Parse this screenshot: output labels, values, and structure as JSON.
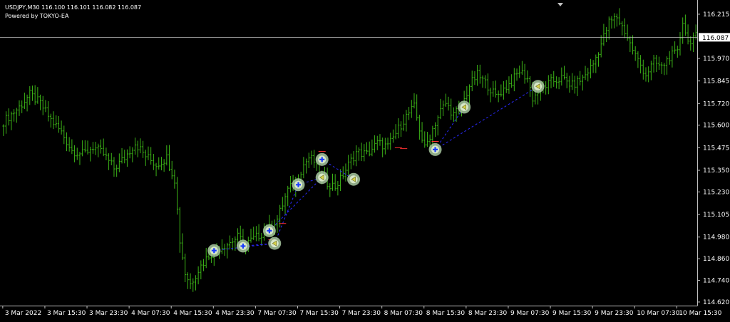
{
  "window": {
    "symbol_line": "USDJPY,M30  116.100 116.101 116.082 116.087",
    "powered_by": "Powered by TOKYO-EA"
  },
  "colors": {
    "background": "#000000",
    "axis": "#c0c0c0",
    "candle": "#3cb317",
    "price_line": "#c0c0c0",
    "current_price_bg": "#ffffff",
    "current_price_text": "#000000",
    "marker_ring": "#a8c8a0",
    "buy_marker": "#1a3cff",
    "sell_marker": "#d6d24a",
    "trade_line": "#2a2aff",
    "level_mark": "#ff3030"
  },
  "chart_data": {
    "type": "candlestick",
    "symbol": "USDJPY",
    "timeframe": "M30",
    "ohlc": [
      116.1,
      116.101,
      116.082,
      116.087
    ],
    "current_price": 116.087,
    "current_price_label": "116.087",
    "ylim": [
      114.6,
      116.27
    ],
    "yticks": [
      {
        "value": 116.215,
        "label": "116.215"
      },
      {
        "value": 115.97,
        "label": "115.970"
      },
      {
        "value": 115.845,
        "label": "115.845"
      },
      {
        "value": 115.72,
        "label": "115.720"
      },
      {
        "value": 115.6,
        "label": "115.600"
      },
      {
        "value": 115.475,
        "label": "115.475"
      },
      {
        "value": 115.35,
        "label": "115.350"
      },
      {
        "value": 115.23,
        "label": "115.230"
      },
      {
        "value": 115.105,
        "label": "115.105"
      },
      {
        "value": 114.98,
        "label": "114.980"
      },
      {
        "value": 114.86,
        "label": "114.860"
      },
      {
        "value": 114.74,
        "label": "114.740"
      },
      {
        "value": 114.62,
        "label": "114.620"
      }
    ],
    "xticks": [
      {
        "index": 0,
        "label": "3 Mar 2022"
      },
      {
        "index": 16,
        "label": "3 Mar 15:30"
      },
      {
        "index": 32,
        "label": "3 Mar 23:30"
      },
      {
        "index": 48,
        "label": "4 Mar 07:30"
      },
      {
        "index": 64,
        "label": "4 Mar 15:30"
      },
      {
        "index": 80,
        "label": "4 Mar 23:30"
      },
      {
        "index": 96,
        "label": "7 Mar 07:30"
      },
      {
        "index": 112,
        "label": "7 Mar 15:30"
      },
      {
        "index": 128,
        "label": "7 Mar 23:30"
      },
      {
        "index": 144,
        "label": "8 Mar 07:30"
      },
      {
        "index": 160,
        "label": "8 Mar 15:30"
      },
      {
        "index": 176,
        "label": "8 Mar 23:30"
      },
      {
        "index": 192,
        "label": "9 Mar 07:30"
      },
      {
        "index": 208,
        "label": "9 Mar 15:30"
      },
      {
        "index": 224,
        "label": "9 Mar 23:30"
      },
      {
        "index": 240,
        "label": "10 Mar 07:30"
      },
      {
        "index": 256,
        "label": "10 Mar 15:30"
      }
    ],
    "anchors": [
      [
        0,
        115.62
      ],
      [
        6,
        115.7
      ],
      [
        10,
        115.77
      ],
      [
        14,
        115.72
      ],
      [
        18,
        115.63
      ],
      [
        22,
        115.56
      ],
      [
        26,
        115.46
      ],
      [
        30,
        115.44
      ],
      [
        34,
        115.48
      ],
      [
        38,
        115.44
      ],
      [
        42,
        115.36
      ],
      [
        46,
        115.42
      ],
      [
        50,
        115.5
      ],
      [
        54,
        115.43
      ],
      [
        58,
        115.38
      ],
      [
        62,
        115.42
      ],
      [
        65,
        115.3
      ],
      [
        67,
        114.96
      ],
      [
        69,
        114.78
      ],
      [
        71,
        114.72
      ],
      [
        74,
        114.8
      ],
      [
        78,
        114.88
      ],
      [
        82,
        114.92
      ],
      [
        86,
        114.95
      ],
      [
        89,
        114.98
      ],
      [
        92,
        114.94
      ],
      [
        95,
        114.97
      ],
      [
        98,
        115.0
      ],
      [
        101,
        115.03
      ],
      [
        104,
        115.08
      ],
      [
        106,
        115.16
      ],
      [
        108,
        115.24
      ],
      [
        110,
        115.27
      ],
      [
        112,
        115.32
      ],
      [
        114,
        115.38
      ],
      [
        116,
        115.42
      ],
      [
        118,
        115.4
      ],
      [
        120,
        115.32
      ],
      [
        123,
        115.28
      ],
      [
        126,
        115.26
      ],
      [
        128,
        115.3
      ],
      [
        131,
        115.38
      ],
      [
        134,
        115.45
      ],
      [
        138,
        115.44
      ],
      [
        142,
        115.5
      ],
      [
        146,
        115.48
      ],
      [
        150,
        115.58
      ],
      [
        153,
        115.65
      ],
      [
        156,
        115.7
      ],
      [
        158,
        115.58
      ],
      [
        160,
        115.47
      ],
      [
        163,
        115.58
      ],
      [
        166,
        115.68
      ],
      [
        168,
        115.72
      ],
      [
        171,
        115.66
      ],
      [
        174,
        115.7
      ],
      [
        177,
        115.82
      ],
      [
        180,
        115.88
      ],
      [
        184,
        115.82
      ],
      [
        187,
        115.76
      ],
      [
        190,
        115.8
      ],
      [
        193,
        115.84
      ],
      [
        196,
        115.9
      ],
      [
        199,
        115.86
      ],
      [
        201,
        115.75
      ],
      [
        204,
        115.8
      ],
      [
        208,
        115.84
      ],
      [
        212,
        115.86
      ],
      [
        216,
        115.82
      ],
      [
        220,
        115.86
      ],
      [
        224,
        115.94
      ],
      [
        227,
        116.05
      ],
      [
        230,
        116.17
      ],
      [
        233,
        116.2
      ],
      [
        236,
        116.12
      ],
      [
        238,
        116.05
      ],
      [
        241,
        115.96
      ],
      [
        244,
        115.88
      ],
      [
        247,
        115.95
      ],
      [
        250,
        115.92
      ],
      [
        253,
        115.98
      ],
      [
        256,
        116.0
      ],
      [
        258,
        116.18
      ],
      [
        260,
        116.06
      ],
      [
        262,
        116.09
      ]
    ],
    "markers": [
      {
        "index": 80,
        "price": 114.905,
        "type": "buy"
      },
      {
        "index": 91,
        "price": 114.93,
        "type": "buy"
      },
      {
        "index": 101,
        "price": 115.015,
        "type": "buy"
      },
      {
        "index": 103,
        "price": 114.945,
        "type": "sell"
      },
      {
        "index": 112,
        "price": 115.27,
        "type": "buy"
      },
      {
        "index": 121,
        "price": 115.41,
        "type": "buy"
      },
      {
        "index": 121,
        "price": 115.31,
        "type": "sell"
      },
      {
        "index": 133,
        "price": 115.3,
        "type": "sell"
      },
      {
        "index": 164,
        "price": 115.465,
        "type": "buy"
      },
      {
        "index": 175,
        "price": 115.7,
        "type": "sell"
      },
      {
        "index": 203,
        "price": 115.815,
        "type": "sell"
      }
    ],
    "trade_lines": [
      [
        [
          80,
          114.905
        ],
        [
          103,
          114.945
        ]
      ],
      [
        [
          91,
          114.93
        ],
        [
          103,
          114.945
        ]
      ],
      [
        [
          101,
          115.015
        ],
        [
          121,
          115.31
        ]
      ],
      [
        [
          112,
          115.27
        ],
        [
          121,
          115.31
        ]
      ],
      [
        [
          121,
          115.41
        ],
        [
          133,
          115.3
        ]
      ],
      [
        [
          103,
          114.945
        ],
        [
          112,
          115.27
        ]
      ],
      [
        [
          164,
          115.465
        ],
        [
          175,
          115.7
        ]
      ],
      [
        [
          164,
          115.465
        ],
        [
          203,
          115.815
        ]
      ]
    ],
    "level_marks": [
      [
        102,
        114.965
      ],
      [
        106,
        115.055
      ],
      [
        121,
        115.455
      ],
      [
        150,
        115.475
      ],
      [
        164,
        115.51
      ],
      [
        152,
        115.47
      ]
    ]
  }
}
